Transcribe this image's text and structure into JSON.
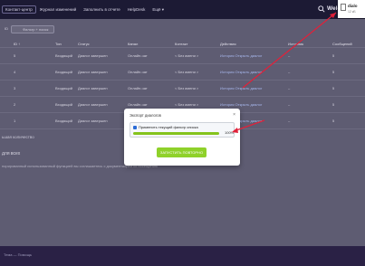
{
  "topbar": {
    "nav": [
      "Контакт-центр",
      "Журнал изменений",
      "Заполнить в отчете",
      "HelpDesk",
      "Ещё ▾"
    ],
    "welcome": "Welc"
  },
  "download": {
    "file_name": "dialo",
    "file_size": "12 кБ"
  },
  "toolbar": {
    "pin": "ID",
    "search_placeholder": "Фильтр + поиск"
  },
  "table": {
    "headers": [
      "ID ↑",
      "Тип",
      "Статус",
      "Канал",
      "Контакт",
      "Действия",
      "Источник",
      "Сообщений"
    ],
    "rows": [
      [
        "5",
        "Входящий",
        "Диалог завершен",
        "Онлайн-чат",
        "< Без имени >",
        "История  Открыть диалог",
        "–",
        "5"
      ],
      [
        "4",
        "Входящий",
        "Диалог завершен",
        "Онлайн-чат",
        "< Без имени >",
        "История  Открыть диалог",
        "–",
        "5"
      ],
      [
        "3",
        "Входящий",
        "Диалог завершен",
        "Онлайн-чат",
        "< Без имени >",
        "История  Открыть диалог",
        "–",
        "5"
      ],
      [
        "2",
        "Входящий",
        "Диалог завершен",
        "Онлайн-чат",
        "< Без имени >",
        "История  Открыть диалог",
        "–",
        "5"
      ],
      [
        "1",
        "Входящий",
        "Диалог завершен",
        "Онлайн-чат",
        "< Без имени >",
        "История  Открыть диалог",
        "–",
        "5"
      ]
    ]
  },
  "pager": {
    "left": "ьшая количество",
    "right": "Страницы:"
  },
  "section": {
    "label": "для всех",
    "hint": "порированный использованный функцией вы соглашаетесь с документацией ко посещению"
  },
  "footer": {
    "text": "Тема — Помощь"
  },
  "modal": {
    "title": "Экспорт диалогов",
    "close": "×",
    "checkbox_label": "Применить текущий фильтр списка",
    "progress_text": "100%",
    "progress_value": 1.0,
    "button": "ЗАПУСТИТЬ ПОВТОРНО"
  },
  "colors": {
    "accent": "#84c31c",
    "arrow": "#e0213a"
  }
}
